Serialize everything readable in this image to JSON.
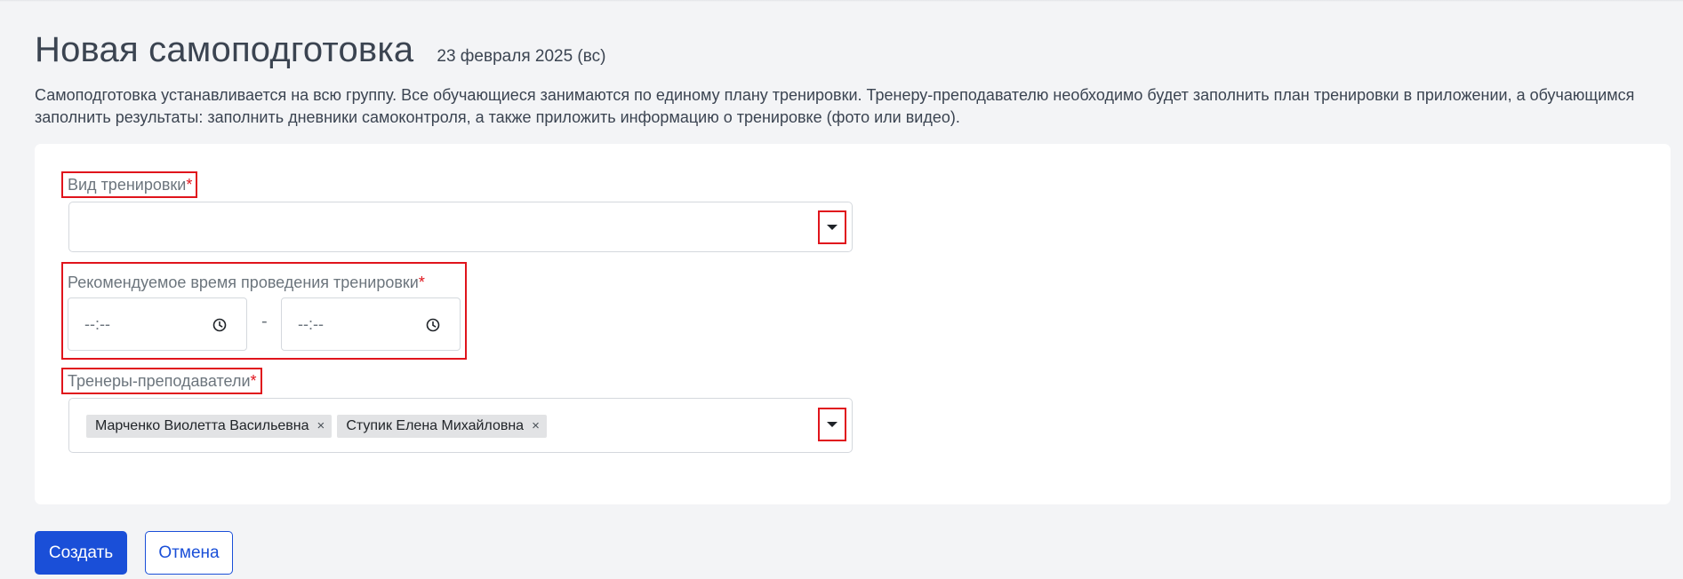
{
  "header": {
    "title": "Новая самоподготовка",
    "date": "23 февраля 2025 (вс)"
  },
  "description": "Самоподготовка устанавливается на всю группу. Все обучающиеся занимаются по единому плану тренировки. Тренеру-преподавателю необходимо будет заполнить план тренировки в приложении, а обучающимся заполнить результаты: заполнить дневники самоконтроля, а также приложить информацию о тренировке (фото или видео).",
  "form": {
    "training_type": {
      "label": "Вид тренировки",
      "required_mark": "*",
      "value": ""
    },
    "recommended_time": {
      "label": "Рекомендуемое время проведения тренировки",
      "required_mark": "*",
      "start_placeholder": "--:--",
      "separator": "-",
      "end_placeholder": "--:--"
    },
    "trainers": {
      "label": "Тренеры-преподаватели",
      "required_mark": "*",
      "selected": [
        {
          "name": "Марченко Виолетта Васильевна",
          "remove": "×"
        },
        {
          "name": "Ступик Елена Михайловна",
          "remove": "×"
        }
      ]
    }
  },
  "actions": {
    "create_label": "Создать",
    "cancel_label": "Отмена"
  },
  "colors": {
    "primary": "#1a4fd8",
    "required": "#e0141c",
    "highlight_border": "#e0141c"
  },
  "icons": [
    "clock-icon",
    "chevron-down-icon",
    "remove-icon"
  ]
}
